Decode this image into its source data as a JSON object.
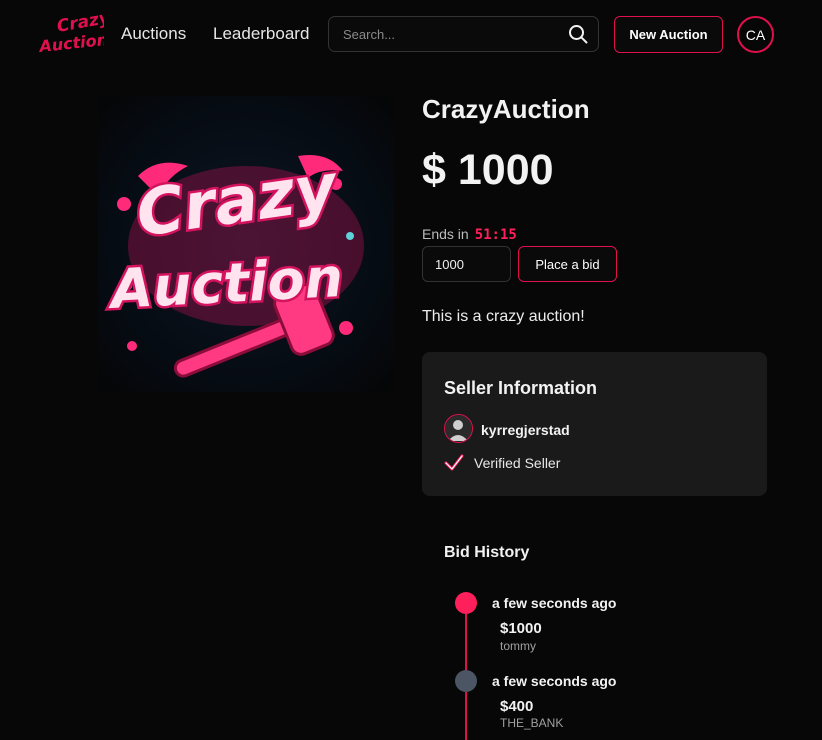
{
  "header": {
    "logo_text": [
      "Crazy",
      "Auction"
    ],
    "nav": [
      {
        "label": "Auctions"
      },
      {
        "label": "Leaderboard"
      }
    ],
    "search": {
      "placeholder": "Search..."
    },
    "new_auction_label": "New Auction",
    "user_initials": "CA"
  },
  "product": {
    "image_text": [
      "Crazy",
      "Auction"
    ],
    "title": "CrazyAuction",
    "price": "$ 1000",
    "ends_label": "Ends in",
    "ends_timer": "51:15",
    "bid_input_value": "1000",
    "place_bid_label": "Place a bid",
    "description": "This is a crazy auction!"
  },
  "seller": {
    "heading": "Seller Information",
    "username": "kyrregjerstad",
    "verified_label": "Verified Seller"
  },
  "bid_history": {
    "title": "Bid History",
    "bids": [
      {
        "time": "a few seconds ago",
        "amount": "$1000",
        "bidder": "tommy"
      },
      {
        "time": "a few seconds ago",
        "amount": "$400",
        "bidder": "THE_BANK"
      }
    ]
  },
  "colors": {
    "accent": "#e0104e",
    "timer": "#ff1f5a",
    "background": "#070707",
    "card": "#1a1a1b",
    "inactive_dot": "#4b5563"
  }
}
